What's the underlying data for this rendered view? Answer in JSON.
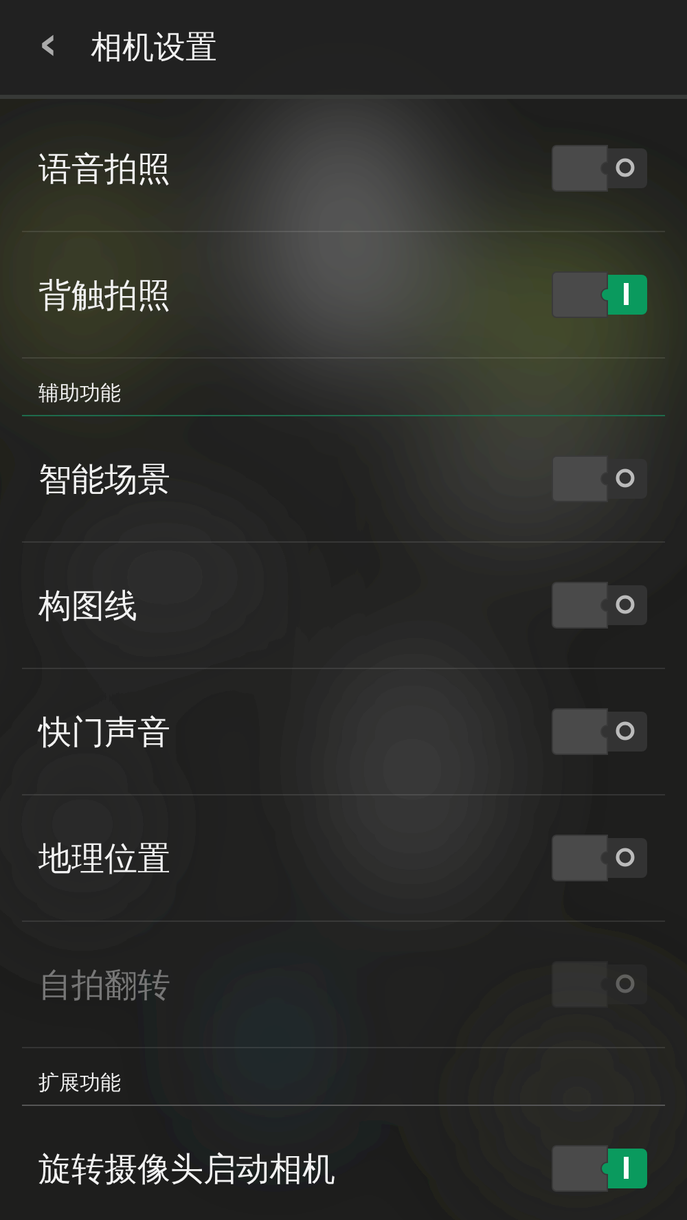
{
  "header": {
    "back": "‹",
    "title": "相机设置"
  },
  "sections": [
    {
      "items": [
        {
          "label": "语音拍照",
          "on": false,
          "disabled": false
        },
        {
          "label": "背触拍照",
          "on": true,
          "disabled": false
        }
      ]
    },
    {
      "title": "辅助功能",
      "items": [
        {
          "label": "智能场景",
          "on": false,
          "disabled": false
        },
        {
          "label": "构图线",
          "on": false,
          "disabled": false
        },
        {
          "label": "快门声音",
          "on": false,
          "disabled": false
        },
        {
          "label": "地理位置",
          "on": false,
          "disabled": false
        },
        {
          "label": "自拍翻转",
          "on": false,
          "disabled": true
        }
      ]
    },
    {
      "title": "扩展功能",
      "items": [
        {
          "label": "旋转摄像头启动相机",
          "on": true,
          "disabled": false
        }
      ]
    }
  ]
}
